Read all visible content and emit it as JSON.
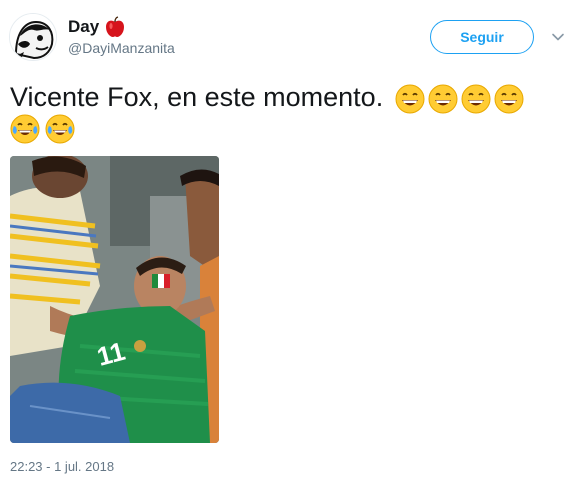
{
  "user": {
    "display_name": "Day",
    "handle": "@DayiManzanita",
    "name_icon": "apple-icon",
    "avatar": "avatar-cartoon-icon"
  },
  "actions": {
    "follow_label": "Seguir",
    "more_icon": "chevron-down-icon"
  },
  "tweet": {
    "text": "Vicente Fox, en este momento.",
    "emojis_line1": [
      "grinning-face-icon",
      "grinning-face-icon",
      "grinning-face-icon",
      "grinning-face-icon"
    ],
    "emojis_line2": [
      "tears-of-joy-icon",
      "tears-of-joy-icon"
    ],
    "media": "photo-fan-jersey-icon",
    "timestamp": "22:23 - 1 jul. 2018"
  },
  "colors": {
    "accent": "#1da1f2",
    "text": "#14171a",
    "secondary": "#657786"
  }
}
